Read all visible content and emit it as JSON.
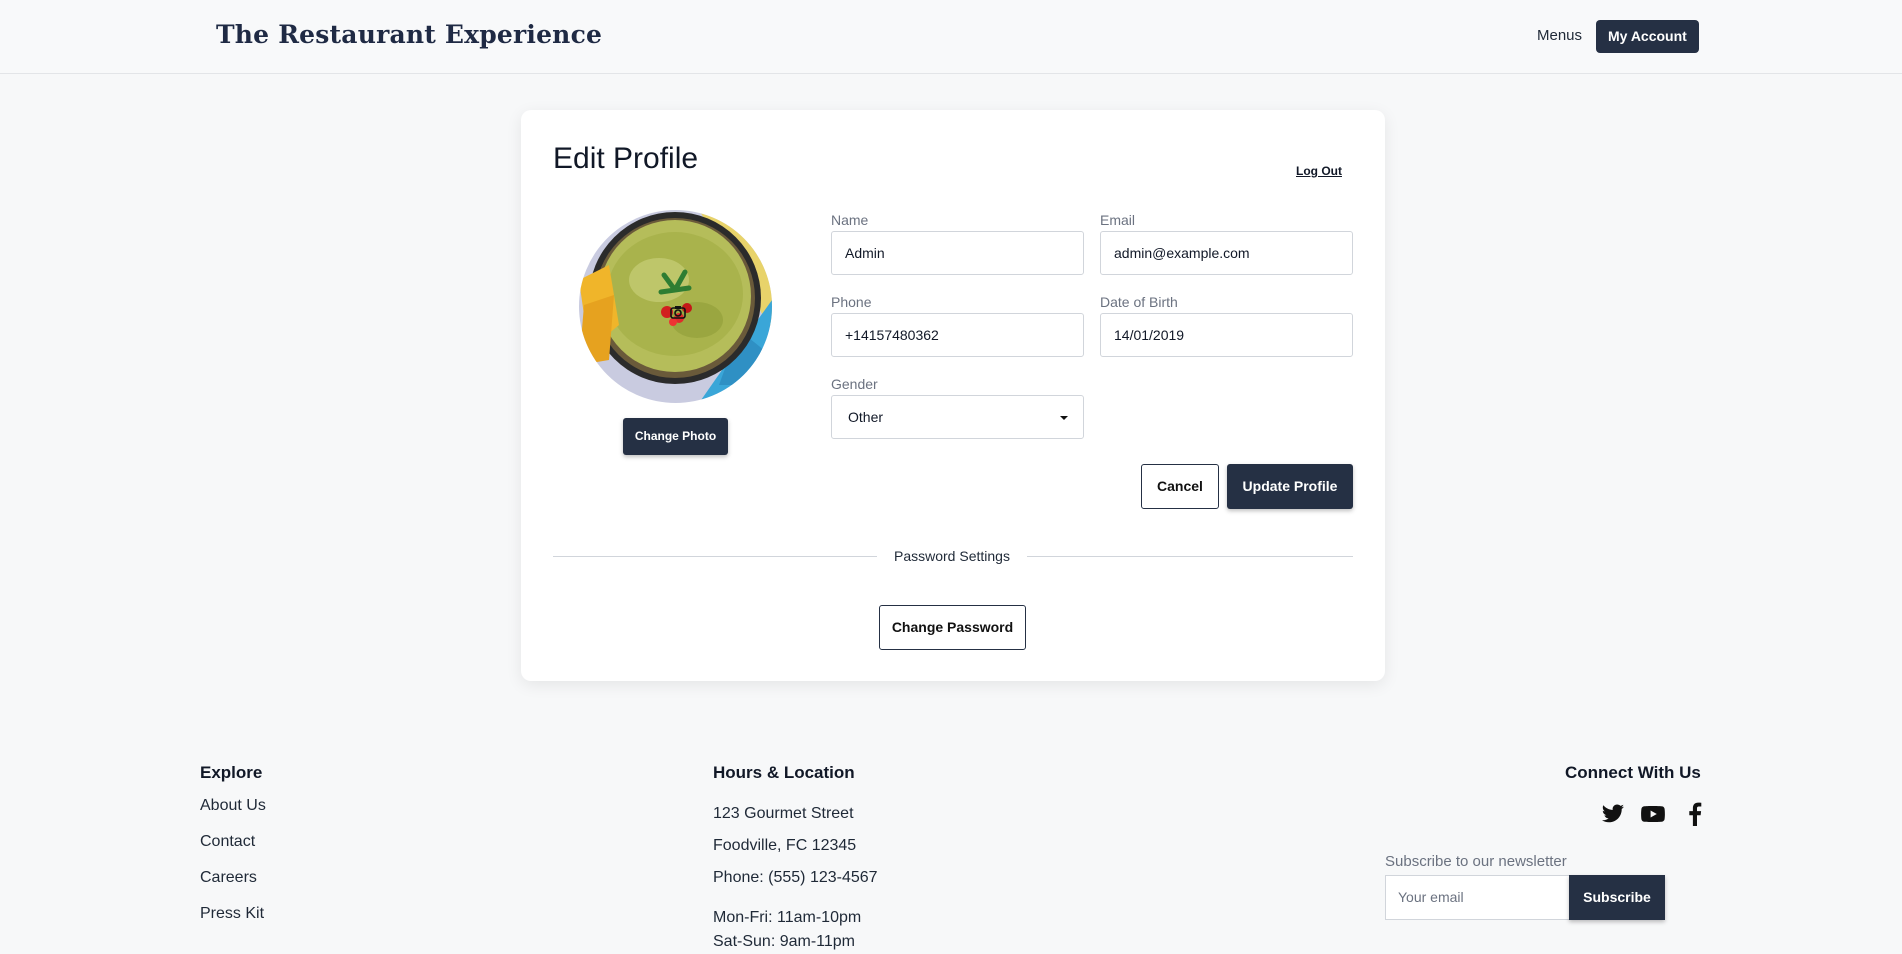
{
  "header": {
    "brand": "The Restaurant Experience",
    "nav_menus": "Menus",
    "nav_account": "My Account"
  },
  "profile": {
    "title": "Edit Profile",
    "logout": "Log Out",
    "change_photo": "Change Photo",
    "name_label": "Name",
    "name_value": "Admin",
    "email_label": "Email",
    "email_value": "admin@example.com",
    "phone_label": "Phone",
    "phone_value": "+14157480362",
    "dob_label": "Date of Birth",
    "dob_value": "14/01/2019",
    "gender_label": "Gender",
    "gender_value": "Other",
    "cancel": "Cancel",
    "update": "Update Profile",
    "password_section": "Password Settings",
    "change_password": "Change Password"
  },
  "footer": {
    "explore": {
      "heading": "Explore",
      "links": [
        "About Us",
        "Contact",
        "Careers",
        "Press Kit"
      ]
    },
    "hours": {
      "heading": "Hours & Location",
      "address1": "123 Gourmet Street",
      "address2": "Foodville, FC 12345",
      "phone": "Phone: (555) 123-4567",
      "weekday": "Mon-Fri: 11am-10pm",
      "weekend": "Sat-Sun: 9am-11pm"
    },
    "connect": {
      "heading": "Connect With Us",
      "icons": [
        "twitter-icon",
        "youtube-icon",
        "facebook-icon"
      ],
      "newsletter_label": "Subscribe to our newsletter",
      "email_placeholder": "Your email",
      "subscribe": "Subscribe"
    }
  },
  "colors": {
    "primary": "#253044",
    "background": "#f7f8f9"
  }
}
